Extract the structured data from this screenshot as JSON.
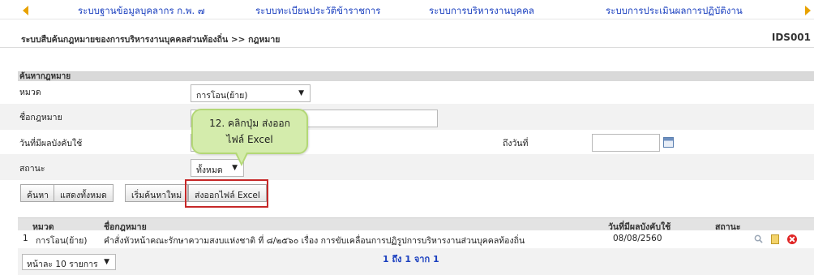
{
  "top_nav": {
    "items": [
      {
        "label": "ระบบฐานข้อมูลบุคลากร ก.พ. ๗"
      },
      {
        "label": "ระบบทะเบียนประวัติข้าราชการ"
      },
      {
        "label": "ระบบการบริหารงานบุคคล"
      },
      {
        "label": "ระบบการประเมินผลการปฏิบัติงาน"
      }
    ]
  },
  "header": {
    "breadcrumb": "ระบบสืบค้นกฎหมายของการบริหารงานบุคคลส่วนท้องถิ่น >> กฎหมาย",
    "screen_code": "IDS001"
  },
  "search": {
    "section_title": "ค้นหากฎหมาย",
    "category_label": "หมวด",
    "category_value": "การโอน(ย้าย)",
    "law_name_label": "ชื่อกฎหมาย",
    "law_name_value": "",
    "effective_date_label": "วันที่มีผลบังคับใช้",
    "effective_date_from": "",
    "to_date_label": "ถึงวันที่",
    "effective_date_to": "",
    "status_label": "สถานะ",
    "status_value": "ทั้งหมด"
  },
  "buttons": {
    "search": "ค้นหา",
    "show_all": "แสดงทั้งหมด",
    "new_search": "เริ่มค้นหาใหม่",
    "export_excel": "ส่งออกไฟล์ Excel"
  },
  "callout": {
    "line1": "12. คลิกปุ่ม ส่งออก",
    "line2": "ไฟล์ Excel"
  },
  "table": {
    "columns": [
      "หมวด",
      "ชื่อกฎหมาย",
      "วันที่มีผลบังคับใช้",
      "สถานะ"
    ],
    "rows": [
      {
        "index": "1",
        "category": "การโอน(ย้าย)",
        "name": "คำสั่งหัวหน้าคณะรักษาความสงบแห่งชาติ ที่ ๘/๒๕๖๐ เรื่อง การขับเคลื่อนการปฏิรูปการบริหารงานส่วนบุคคลท้องถิ่น",
        "effective_date": "08/08/2560",
        "status": ""
      }
    ]
  },
  "pagination": {
    "page_size": "หน้าละ 10 รายการ",
    "summary": "1 ถึง 1 จาก 1"
  },
  "colors": {
    "link": "#1a3fbf",
    "nav_arrow": "#e8a200",
    "highlight_border": "#c62828",
    "callout_fill": "#d4ecac"
  }
}
